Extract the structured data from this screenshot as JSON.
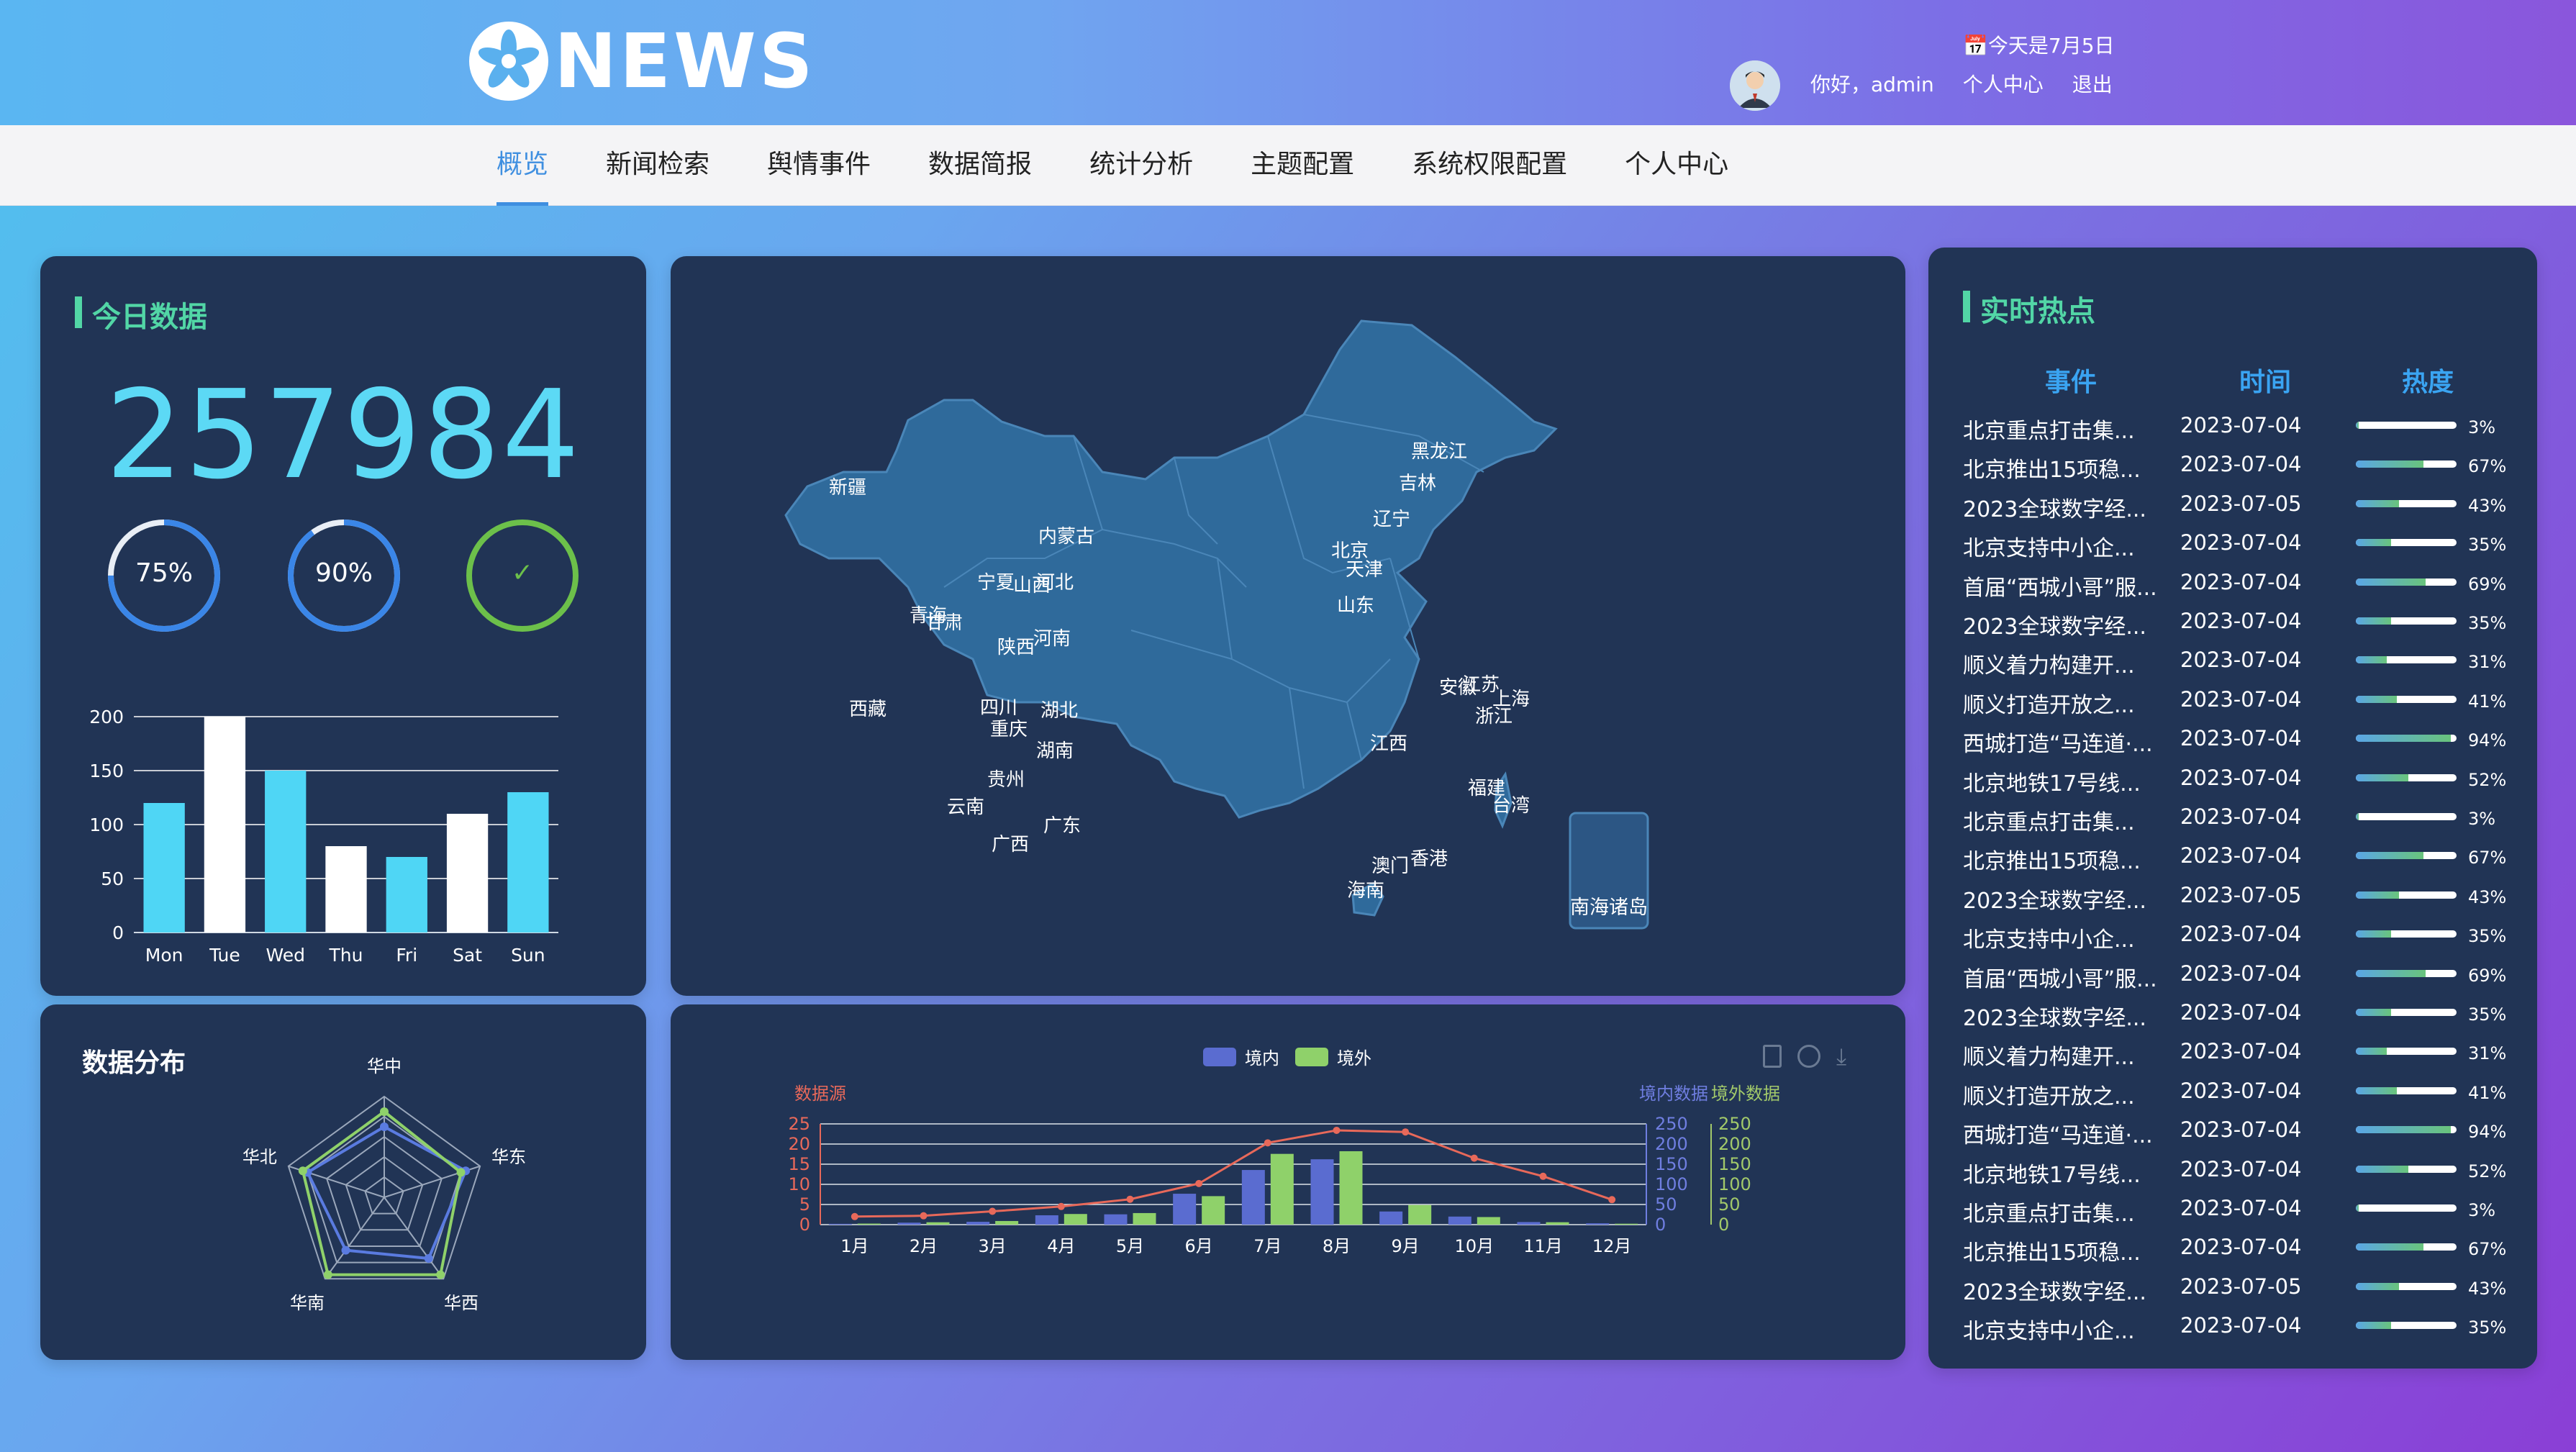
{
  "header": {
    "logo_text": "NEWS",
    "date": "今天是7月5日",
    "greeting": "你好，admin",
    "profile_link": "个人中心",
    "logout_link": "退出"
  },
  "nav": {
    "items": [
      "概览",
      "新闻检索",
      "舆情事件",
      "数据简报",
      "统计分析",
      "主题配置",
      "系统权限配置",
      "个人中心"
    ],
    "active": "概览"
  },
  "today": {
    "title": "今日数据",
    "total": "257984",
    "rings": [
      {
        "label": "75%",
        "value": 0.75,
        "color": "#3a86e8"
      },
      {
        "label": "90%",
        "value": 0.9,
        "color": "#3a86e8"
      },
      {
        "label": "✓",
        "value": 1.0,
        "color": "#6cc04a"
      }
    ]
  },
  "distribution": {
    "title": "数据分布"
  },
  "hot": {
    "title": "实时热点",
    "columns": [
      "事件",
      "时间",
      "热度"
    ],
    "rows": [
      {
        "event": "北京重点打击集...",
        "time": "2023-07-04",
        "heat": "3%",
        "value": 0.03
      },
      {
        "event": "北京推出15项稳...",
        "time": "2023-07-04",
        "heat": "67%",
        "value": 0.67
      },
      {
        "event": "2023全球数字经...",
        "time": "2023-07-05",
        "heat": "43%",
        "value": 0.43
      },
      {
        "event": "北京支持中小企...",
        "time": "2023-07-04",
        "heat": "35%",
        "value": 0.35
      },
      {
        "event": "首届“西城小哥”服...",
        "time": "2023-07-04",
        "heat": "69%",
        "value": 0.69
      },
      {
        "event": "2023全球数字经...",
        "time": "2023-07-04",
        "heat": "35%",
        "value": 0.35
      },
      {
        "event": "顺义着力构建开...",
        "time": "2023-07-04",
        "heat": "31%",
        "value": 0.31
      },
      {
        "event": "顺义打造开放之...",
        "time": "2023-07-04",
        "heat": "41%",
        "value": 0.41
      },
      {
        "event": "西城打造“马连道·...",
        "time": "2023-07-04",
        "heat": "94%",
        "value": 0.94
      },
      {
        "event": "北京地铁17号线...",
        "time": "2023-07-04",
        "heat": "52%",
        "value": 0.52
      },
      {
        "event": "北京重点打击集...",
        "time": "2023-07-04",
        "heat": "3%",
        "value": 0.03
      },
      {
        "event": "北京推出15项稳...",
        "time": "2023-07-04",
        "heat": "67%",
        "value": 0.67
      },
      {
        "event": "2023全球数字经...",
        "time": "2023-07-05",
        "heat": "43%",
        "value": 0.43
      },
      {
        "event": "北京支持中小企...",
        "time": "2023-07-04",
        "heat": "35%",
        "value": 0.35
      },
      {
        "event": "首届“西城小哥”服...",
        "time": "2023-07-04",
        "heat": "69%",
        "value": 0.69
      },
      {
        "event": "2023全球数字经...",
        "time": "2023-07-04",
        "heat": "35%",
        "value": 0.35
      },
      {
        "event": "顺义着力构建开...",
        "time": "2023-07-04",
        "heat": "31%",
        "value": 0.31
      },
      {
        "event": "顺义打造开放之...",
        "time": "2023-07-04",
        "heat": "41%",
        "value": 0.41
      },
      {
        "event": "西城打造“马连道·...",
        "time": "2023-07-04",
        "heat": "94%",
        "value": 0.94
      },
      {
        "event": "北京地铁17号线...",
        "time": "2023-07-04",
        "heat": "52%",
        "value": 0.52
      },
      {
        "event": "北京重点打击集...",
        "time": "2023-07-04",
        "heat": "3%",
        "value": 0.03
      },
      {
        "event": "北京推出15项稳...",
        "time": "2023-07-04",
        "heat": "67%",
        "value": 0.67
      },
      {
        "event": "2023全球数字经...",
        "time": "2023-07-05",
        "heat": "43%",
        "value": 0.43
      },
      {
        "event": "北京支持中小企...",
        "time": "2023-07-04",
        "heat": "35%",
        "value": 0.35
      }
    ]
  },
  "map": {
    "inset_label": "南海诸岛",
    "provinces": [
      "新疆",
      "西藏",
      "青海",
      "甘肃",
      "宁夏",
      "内蒙古",
      "黑龙江",
      "吉林",
      "辽宁",
      "北京",
      "天津",
      "山西",
      "河北",
      "山东",
      "陕西",
      "河南",
      "四川",
      "重庆",
      "湖北",
      "安徽",
      "江苏",
      "上海",
      "浙江",
      "湖南",
      "江西",
      "贵州",
      "云南",
      "广西",
      "广东",
      "福建",
      "台湾",
      "澳门",
      "香港",
      "海南"
    ]
  },
  "chart_data": [
    {
      "type": "bar",
      "categories": [
        "Mon",
        "Tue",
        "Wed",
        "Thu",
        "Fri",
        "Sat",
        "Sun"
      ],
      "values": [
        120,
        200,
        150,
        80,
        70,
        110,
        130
      ],
      "ylim": [
        0,
        200
      ],
      "yticks": [
        0,
        50,
        100,
        150,
        200
      ],
      "colors": [
        "#4fd6f5",
        "#ffffff"
      ],
      "grid": true
    },
    {
      "type": "radar",
      "indicators": [
        "华中",
        "华东",
        "华西",
        "华南",
        "华北"
      ],
      "series": [
        {
          "values": [
            0.7,
            0.85,
            0.75,
            0.65,
            0.8
          ],
          "color": "#5a7be0"
        },
        {
          "values": [
            0.85,
            0.8,
            0.95,
            0.95,
            0.85
          ],
          "color": "#8fd16a"
        }
      ]
    },
    {
      "type": "bar",
      "categories": [
        "1月",
        "2月",
        "3月",
        "4月",
        "5月",
        "6月",
        "7月",
        "8月",
        "9月",
        "10月",
        "11月",
        "12月"
      ],
      "legend": [
        "境内",
        "境外"
      ],
      "legend_position": "top",
      "axis_titles": {
        "left": "数据源",
        "right1": "境内数据",
        "right2": "境外数据"
      },
      "yticks_left": [
        0,
        5,
        10,
        15,
        20,
        25
      ],
      "yticks_right": [
        0,
        50,
        100,
        150,
        200,
        250
      ],
      "series": [
        {
          "name": "境内",
          "type": "bar",
          "color": "#5a6cd0",
          "values": [
            2.0,
            4.9,
            7.0,
            23.2,
            25.6,
            76.7,
            135.6,
            162.2,
            32.6,
            20.0,
            6.4,
            3.3
          ]
        },
        {
          "name": "境外",
          "type": "bar",
          "color": "#8fd16a",
          "values": [
            2.6,
            5.9,
            9.0,
            26.4,
            28.7,
            70.7,
            175.6,
            182.2,
            48.7,
            18.8,
            6.0,
            2.3
          ]
        },
        {
          "type": "line",
          "color": "#e8695a",
          "values": [
            2.0,
            2.2,
            3.3,
            4.5,
            6.3,
            10.2,
            20.3,
            23.4,
            23.0,
            16.5,
            12.0,
            6.2
          ]
        }
      ],
      "ylim_left": [
        0,
        25
      ],
      "ylim_right": [
        0,
        250
      ]
    }
  ]
}
